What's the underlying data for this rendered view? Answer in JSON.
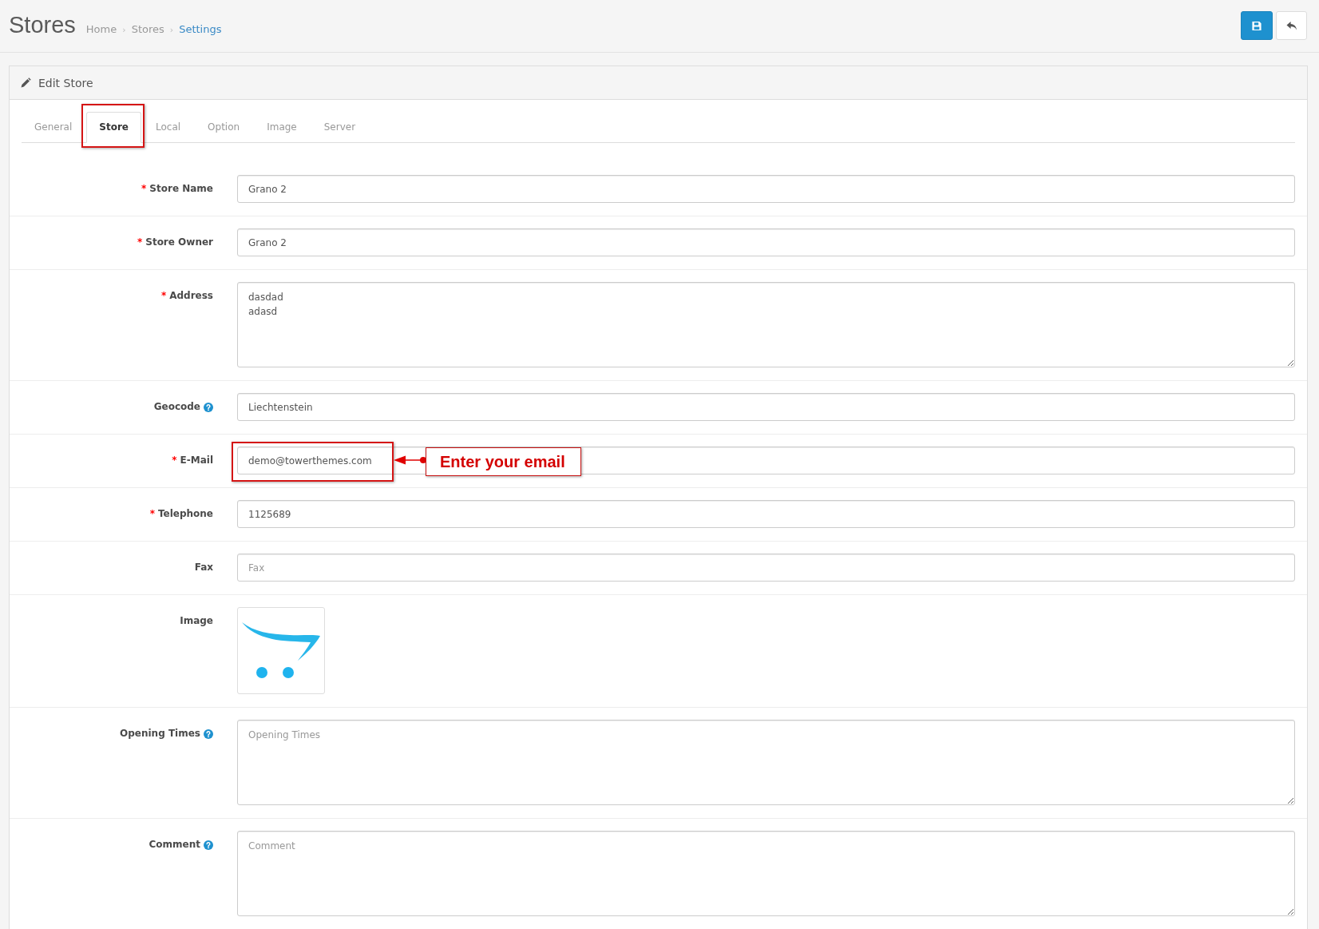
{
  "header": {
    "title": "Stores",
    "breadcrumbs": [
      {
        "label": "Home",
        "current": false
      },
      {
        "separator": "›",
        "label": "Stores",
        "current": false
      },
      {
        "separator": "›",
        "label": "Settings",
        "current": true
      }
    ],
    "buttons": [
      {
        "kind": "save"
      },
      {
        "kind": "back"
      }
    ]
  },
  "panel": {
    "title": "Edit Store",
    "tabs": [
      {
        "label": "General",
        "selected": false,
        "highlighted": false
      },
      {
        "label": "Store",
        "selected": true,
        "highlighted": true
      },
      {
        "label": "Local",
        "selected": false,
        "highlighted": false
      },
      {
        "label": "Option",
        "selected": false,
        "highlighted": false
      },
      {
        "label": "Image",
        "selected": false,
        "highlighted": false
      },
      {
        "label": "Server",
        "selected": false,
        "highlighted": false
      }
    ],
    "fields": [
      {
        "kind": "text",
        "required_mark": "*",
        "label": "Store Name",
        "help": false,
        "value": "Grano 2",
        "highlighted": false
      },
      {
        "kind": "text",
        "required_mark": "*",
        "label": "Store Owner",
        "help": false,
        "value": "Grano 2",
        "highlighted": false
      },
      {
        "kind": "textarea",
        "required_mark": "*",
        "label": "Address",
        "help": false,
        "value": "dasdad\nadasd",
        "highlighted": false
      },
      {
        "kind": "text",
        "label": "Geocode",
        "help": true,
        "value": "Liechtenstein",
        "highlighted": false
      },
      {
        "kind": "text",
        "required_mark": "*",
        "label": "E-Mail",
        "help": false,
        "value": "demo@towerthemes.com",
        "highlighted": true,
        "callout": "Enter your email"
      },
      {
        "kind": "text",
        "required_mark": "*",
        "label": "Telephone",
        "help": false,
        "value": "1125689",
        "highlighted": false
      },
      {
        "kind": "text",
        "label": "Fax",
        "help": false,
        "placeholder": "Fax",
        "highlighted": false
      },
      {
        "kind": "image",
        "label": "Image",
        "help": false,
        "highlighted": false
      },
      {
        "kind": "textarea",
        "label": "Opening Times",
        "help": true,
        "placeholder": "Opening Times",
        "highlighted": false
      },
      {
        "kind": "textarea",
        "label": "Comment",
        "help": true,
        "placeholder": "Comment",
        "highlighted": false
      }
    ]
  }
}
